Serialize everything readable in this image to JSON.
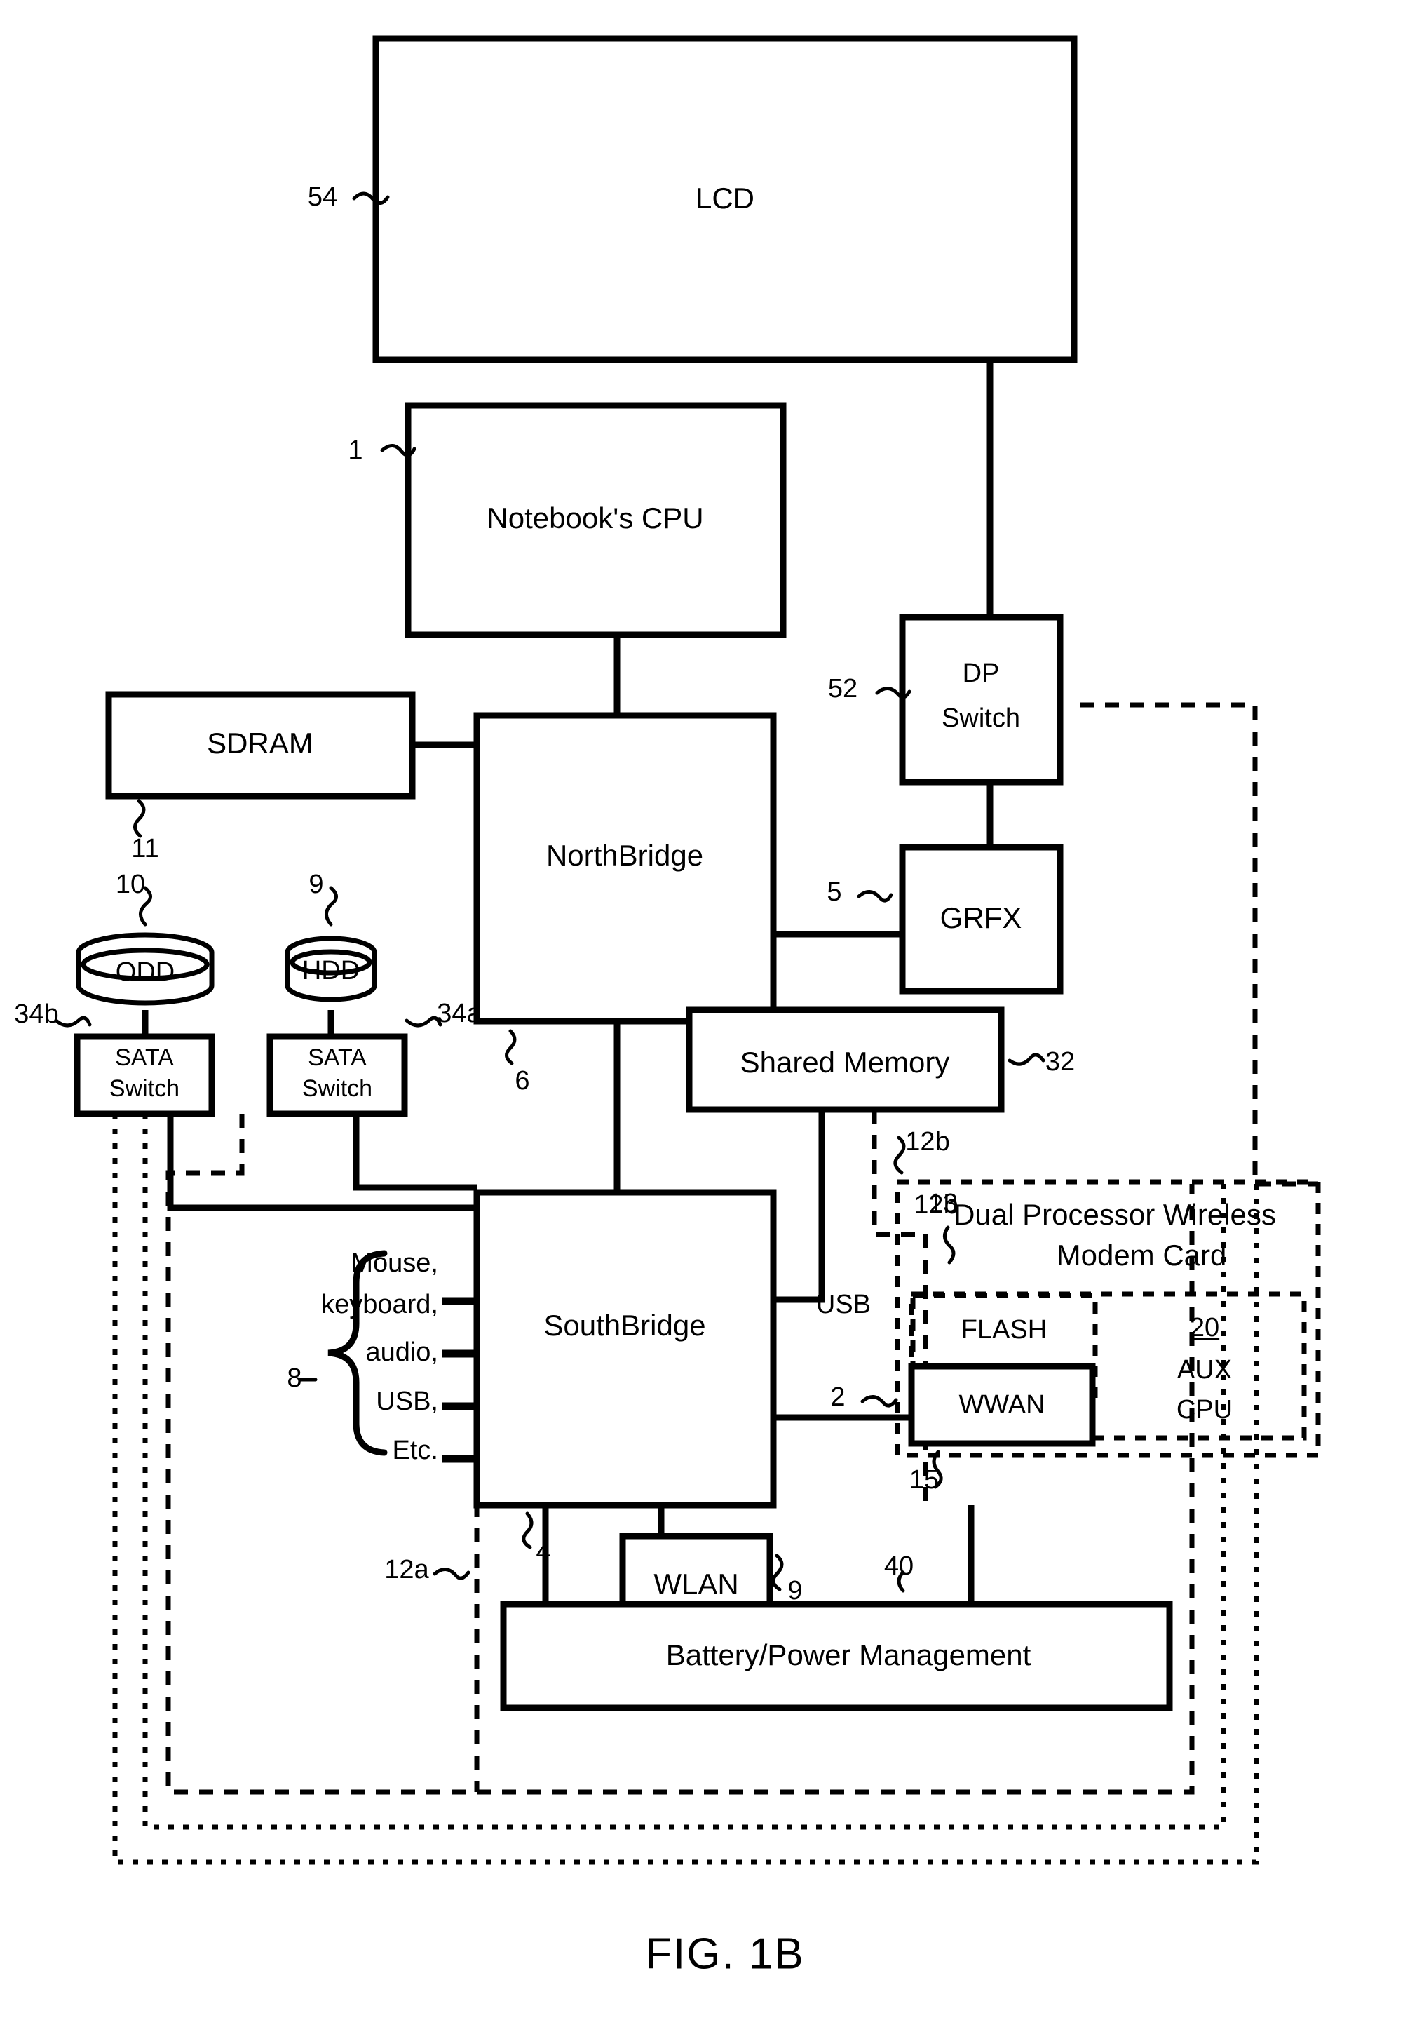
{
  "figure": {
    "caption": "FIG. 1B",
    "title": "Notebook computer architecture block diagram with dual processor wireless modem card"
  },
  "blocks": {
    "lcd": {
      "label": "LCD",
      "ref": "54"
    },
    "notebook_cpu": {
      "label": "Notebook's CPU",
      "ref": "1"
    },
    "sdram": {
      "label": "SDRAM",
      "ref": "11"
    },
    "northbridge": {
      "label": "NorthBridge",
      "ref": "6"
    },
    "dp_switch": {
      "label_line1": "DP",
      "label_line2": "Switch",
      "ref": "52"
    },
    "grfx": {
      "label": "GRFX",
      "ref": "5"
    },
    "odd": {
      "label": "ODD",
      "ref": "10"
    },
    "hdd": {
      "label": "HDD",
      "ref": "9"
    },
    "sata_switch_b": {
      "label_line1": "SATA",
      "label_line2": "Switch",
      "ref": "34b"
    },
    "sata_switch_a": {
      "label_line1": "SATA",
      "label_line2": "Switch",
      "ref": "34a"
    },
    "shared_memory": {
      "label": "Shared Memory",
      "ref": "32"
    },
    "southbridge": {
      "label": "SouthBridge",
      "ref": "4"
    },
    "wlan": {
      "label": "WLAN",
      "ref": "9"
    },
    "battery": {
      "label": "Battery/Power Management",
      "ref": "40"
    },
    "modem_card": {
      "label_line1": "Dual Processor Wireless",
      "label_line2": "Modem Card",
      "ref": "12b"
    },
    "flash": {
      "label": "FLASH",
      "ref": "13"
    },
    "wwan": {
      "label": "WWAN",
      "ref": "2"
    },
    "aux_cpu": {
      "number": "20",
      "label_line1": "AUX",
      "label_line2": "CPU"
    }
  },
  "connections": {
    "usb_label": "USB",
    "bus_12a_ref": "12a",
    "bus_12b_ref": "12b",
    "wwan_link_ref": "15"
  },
  "io_group": {
    "ref": "8",
    "items": [
      "Mouse,",
      "keyboard,",
      "audio,",
      "USB,",
      "Etc."
    ]
  },
  "colors": {
    "ink": "#000000",
    "paper": "#ffffff"
  }
}
